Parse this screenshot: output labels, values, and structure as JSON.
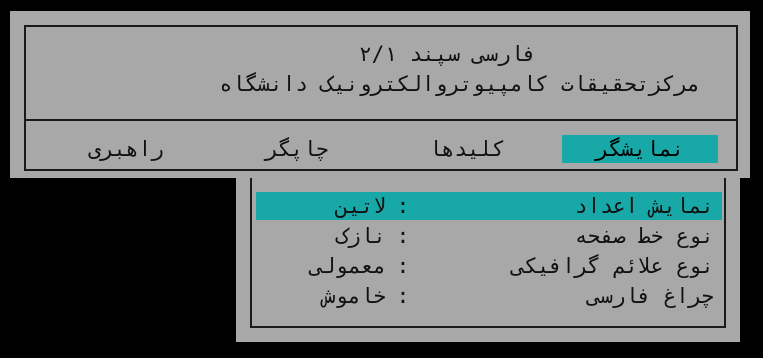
{
  "header": {
    "title_line_1": "فارسی سپند ۲/۱",
    "title_line_2": "مرکزتحقیقات کامپیوتروالکترونیک دانشگاه"
  },
  "menu": {
    "items": [
      {
        "label": "نمایشگر",
        "active": true
      },
      {
        "label": "کلیدها",
        "active": false
      },
      {
        "label": "چاپگر",
        "active": false
      },
      {
        "label": "راهبری",
        "active": false
      }
    ]
  },
  "dropdown": {
    "separator": ":",
    "options": [
      {
        "label": "نمایش اعداد",
        "value": "لاتین",
        "selected": true
      },
      {
        "label": "نوع خط صفحه",
        "value": "نازک",
        "selected": false
      },
      {
        "label": "نوع علائم گرافیکی",
        "value": "معمولی",
        "selected": false
      },
      {
        "label": "چراغ فارسی",
        "value": "خاموش",
        "selected": false
      }
    ]
  },
  "colors": {
    "background": "#000000",
    "window": "#a8a8a8",
    "highlight": "#18a8a8",
    "text": "#111111"
  }
}
